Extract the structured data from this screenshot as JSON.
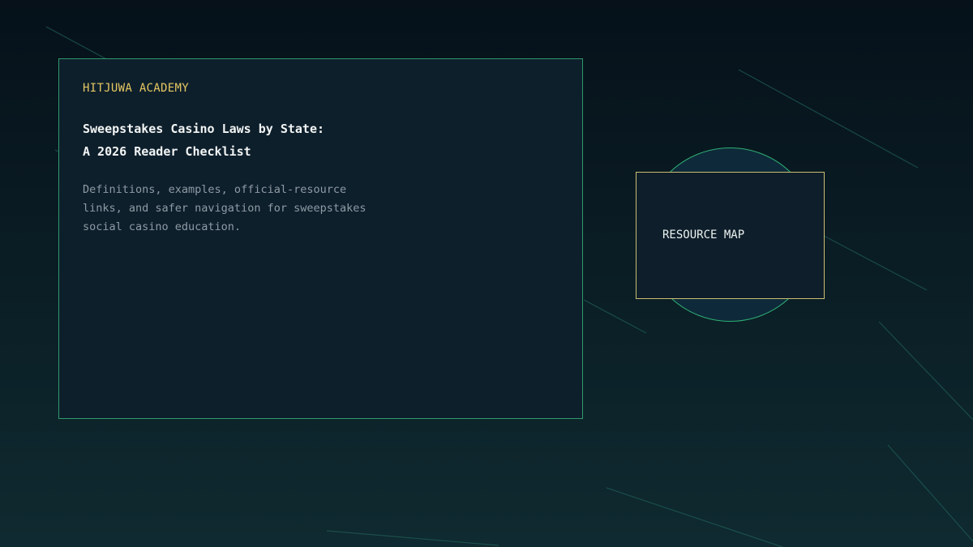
{
  "card": {
    "brand": "HITJUWA ACADEMY",
    "title_line1": "Sweepstakes Casino Laws by State:",
    "title_line2": "A 2026 Reader Checklist",
    "description_lines": [
      "Definitions, examples, official-resource",
      "links, and safer navigation for sweepstakes",
      "social casino education."
    ]
  },
  "resource_map": {
    "label": "RESOURCE MAP"
  },
  "colors": {
    "brand_accent": "#e6c862",
    "card_border": "#2f9a6a",
    "resource_border": "#c9be70",
    "circle_stroke": "#2fae74",
    "background": "#06111a"
  }
}
